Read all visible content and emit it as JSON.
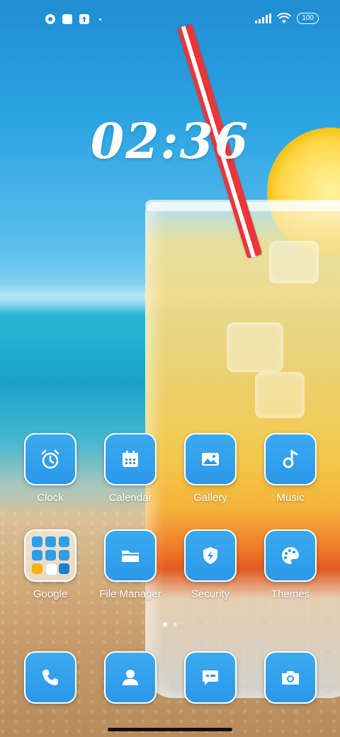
{
  "status_bar": {
    "battery": "100",
    "icons_left": [
      "notification-icon",
      "square-icon",
      "upload-icon"
    ],
    "icons_right": [
      "signal-icon",
      "wifi-icon",
      "battery-icon"
    ]
  },
  "clock": {
    "time": "02:36"
  },
  "apps_row1": [
    {
      "label": "Clock",
      "icon": "alarm-clock-icon"
    },
    {
      "label": "Calendar",
      "icon": "calendar-icon"
    },
    {
      "label": "Gallery",
      "icon": "image-icon"
    },
    {
      "label": "Music",
      "icon": "music-note-icon"
    }
  ],
  "apps_row2": [
    {
      "label": "Google",
      "icon": "folder-icon"
    },
    {
      "label": "File Manager",
      "icon": "folder-icon"
    },
    {
      "label": "Security",
      "icon": "shield-bolt-icon"
    },
    {
      "label": "Themes",
      "icon": "palette-icon"
    }
  ],
  "dock": [
    {
      "icon": "phone-icon"
    },
    {
      "icon": "contacts-icon"
    },
    {
      "icon": "message-icon"
    },
    {
      "icon": "camera-icon"
    }
  ],
  "page_indicator": {
    "pages": 2,
    "active": 1
  },
  "colors": {
    "tile": "#2c98e8",
    "tile_border": "#ffffff"
  }
}
